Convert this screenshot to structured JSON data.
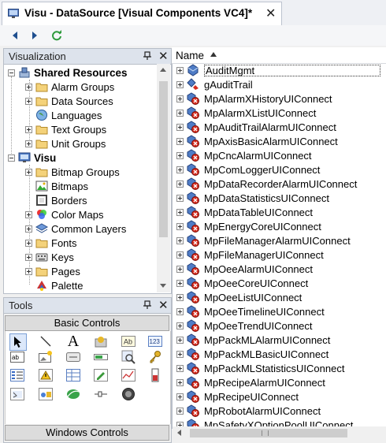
{
  "tab": {
    "title": "Visu - DataSource [Visual Components VC4]*",
    "close": "✕"
  },
  "visualization": {
    "title": "Visualization",
    "shared": {
      "label": "Shared Resources",
      "children": [
        "Alarm Groups",
        "Data Sources",
        "Languages",
        "Text Groups",
        "Unit Groups"
      ]
    },
    "visu": {
      "label": "Visu",
      "children": [
        "Bitmap Groups",
        "Bitmaps",
        "Borders",
        "Color Maps",
        "Common Layers",
        "Fonts",
        "Keys",
        "Pages",
        "Palette"
      ]
    }
  },
  "tools": {
    "title": "Tools",
    "basic_controls": "Basic Controls",
    "windows_controls": "Windows Controls"
  },
  "list": {
    "column_header": "Name",
    "items": [
      "AuditMgmt",
      "gAuditTrail",
      "MpAlarmXHistoryUIConnect",
      "MpAlarmXListUIConnect",
      "MpAuditTrailAlarmUIConnect",
      "MpAxisBasicAlarmUIConnect",
      "MpCncAlarmUIConnect",
      "MpComLoggerUIConnect",
      "MpDataRecorderAlarmUIConnect",
      "MpDataStatisticsUIConnect",
      "MpDataTableUIConnect",
      "MpEnergyCoreUIConnect",
      "MpFileManagerAlarmUIConnect",
      "MpFileManagerUIConnect",
      "MpOeeAlarmUIConnect",
      "MpOeeCoreUIConnect",
      "MpOeeListUIConnect",
      "MpOeeTimelineUIConnect",
      "MpOeeTrendUIConnect",
      "MpPackMLAlarmUIConnect",
      "MpPackMLBasicUIConnect",
      "MpPackMLStatisticsUIConnect",
      "MpRecipeAlarmUIConnect",
      "MpRecipeUIConnect",
      "MpRobotAlarmUIConnect",
      "MpSafetyXOptionPoolUIConnect"
    ]
  },
  "colors": {
    "panel_header": "#dde3ec",
    "accent": "#3a6bc4",
    "nav_arrow": "#1f4f8f",
    "refresh": "#2e9a3c"
  }
}
